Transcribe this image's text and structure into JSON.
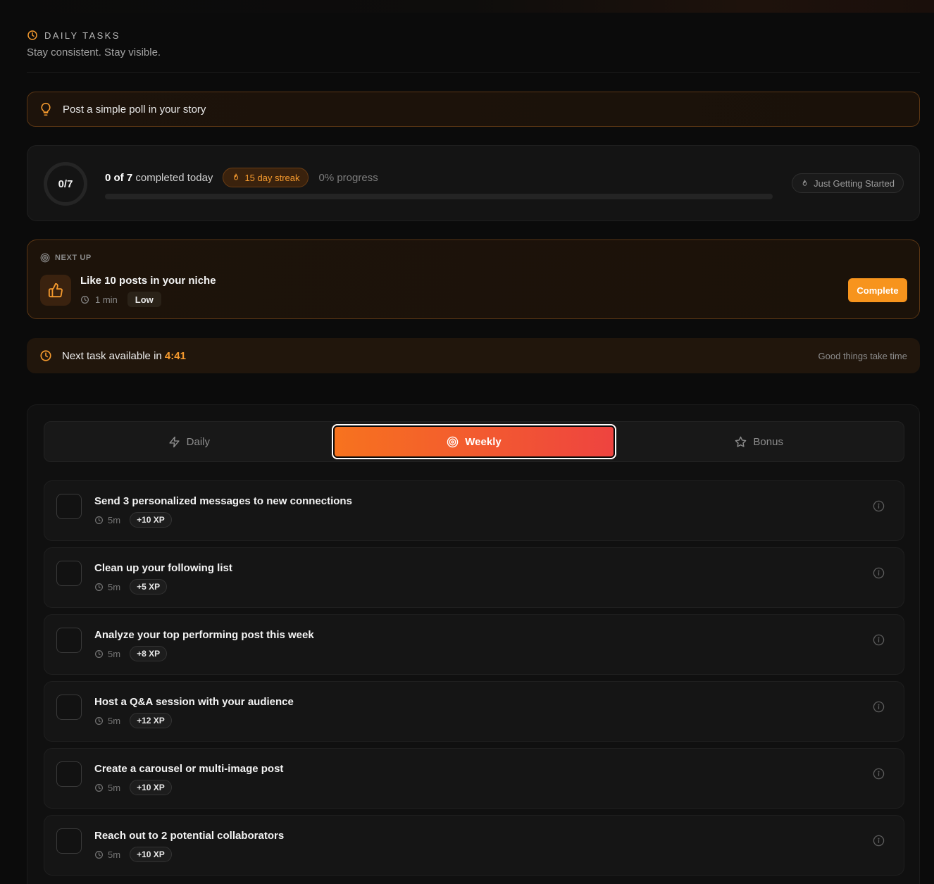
{
  "colors": {
    "accent": "#f7941d",
    "accent_orange": "#f97316",
    "accent_red": "#ee4340",
    "background": "#0b0b0b",
    "card": "#141414"
  },
  "header": {
    "title": "DAILY TASKS",
    "subtitle": "Stay consistent. Stay visible.",
    "icon": "clock-icon"
  },
  "tip": {
    "icon": "lightbulb-icon",
    "text": "Post a simple poll in your story"
  },
  "progress": {
    "ring_label": "0/7",
    "completed_count": "0 of 7",
    "completed_suffix": " completed today",
    "streak": "15 day streak",
    "streak_icon": "flame-icon",
    "percent_label": "0% progress",
    "progress_fraction": 0,
    "level": "Just Getting Started"
  },
  "next_up": {
    "label": "NEXT UP",
    "label_icon": "target-icon",
    "task_icon": "thumbs-up-icon",
    "title": "Like 10 posts in your niche",
    "duration": "1 min",
    "priority": "Low",
    "button": "Complete"
  },
  "timer": {
    "prefix": "Next task available in ",
    "countdown": "4:41",
    "note": "Good things take time"
  },
  "tabs": [
    {
      "label": "Daily",
      "icon": "lightning-icon",
      "active": false
    },
    {
      "label": "Weekly",
      "icon": "target-icon",
      "active": true
    },
    {
      "label": "Bonus",
      "icon": "star-icon",
      "active": false
    }
  ],
  "tasks": [
    {
      "title": "Send 3 personalized messages to new connections",
      "duration": "5m",
      "xp": "+10 XP"
    },
    {
      "title": "Clean up your following list",
      "duration": "5m",
      "xp": "+5 XP"
    },
    {
      "title": "Analyze your top performing post this week",
      "duration": "5m",
      "xp": "+8 XP"
    },
    {
      "title": "Host a Q&A session with your audience",
      "duration": "5m",
      "xp": "+12 XP"
    },
    {
      "title": "Create a carousel or multi-image post",
      "duration": "5m",
      "xp": "+10 XP"
    },
    {
      "title": "Reach out to 2 potential collaborators",
      "duration": "5m",
      "xp": "+10 XP"
    }
  ]
}
